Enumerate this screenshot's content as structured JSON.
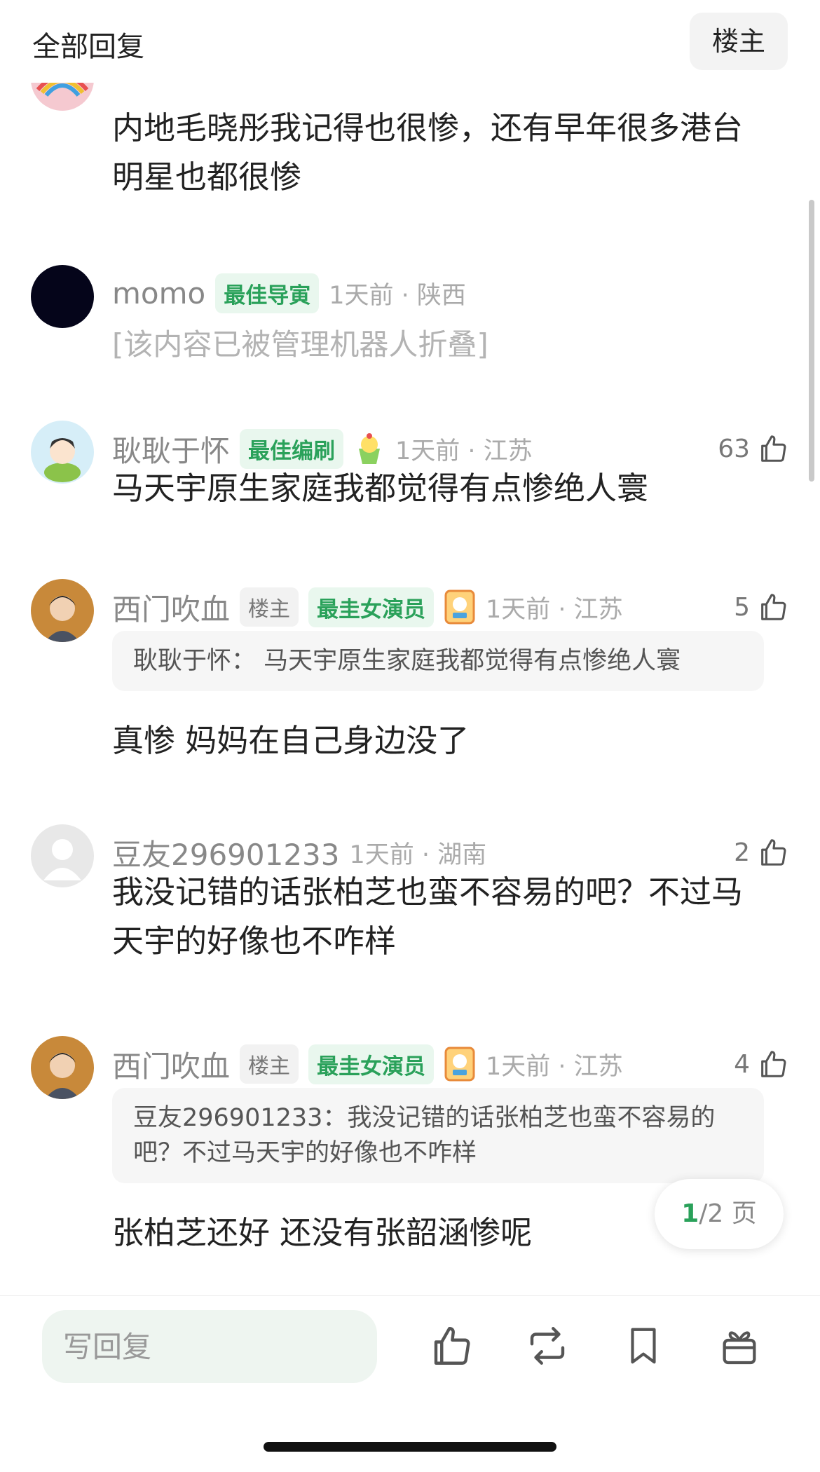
{
  "header": {
    "title": "全部回复",
    "owner_filter": "楼主"
  },
  "comments": [
    {
      "body": "内地毛晓彤我记得也很惨，还有早年很多港台明星也都很惨"
    },
    {
      "username": "momo",
      "award": "最佳导寅",
      "time": "1天前 · 陕西",
      "folded": "[该内容已被管理机器人折叠]"
    },
    {
      "username": "耿耿于怀",
      "award": "最佳编刷",
      "time": "1天前 · 江苏",
      "likes": "63",
      "body": "马天宇原生家庭我都觉得有点惨绝人寰"
    },
    {
      "username": "西门吹血",
      "owner": "楼主",
      "award": "最圭女演员",
      "time": "1天前 · 江苏",
      "likes": "5",
      "quote": "耿耿于怀： 马天宇原生家庭我都觉得有点惨绝人寰",
      "body": "真惨 妈妈在自己身边没了"
    },
    {
      "username": "豆友296901233",
      "time": "1天前 · 湖南",
      "likes": "2",
      "body": "我没记错的话张柏芝也蛮不容易的吧？不过马天宇的好像也不咋样"
    },
    {
      "username": "西门吹血",
      "owner": "楼主",
      "award": "最圭女演员",
      "time": "1天前 · 江苏",
      "likes": "4",
      "quote": "豆友296901233：我没记错的话张柏芝也蛮不容易的吧？不过马天宇的好像也不咋样",
      "body": "张柏芝还好 还没有张韶涵惨呢"
    }
  ],
  "pager": {
    "current": "1",
    "rest": "/2 页"
  },
  "bottom": {
    "reply_placeholder": "写回复"
  },
  "icons": [
    "thumbs-up-icon",
    "repost-icon",
    "bookmark-icon",
    "gift-icon"
  ],
  "colors": {
    "accent_green": "#2aa15a",
    "award_bg": "#e9f7ee"
  }
}
